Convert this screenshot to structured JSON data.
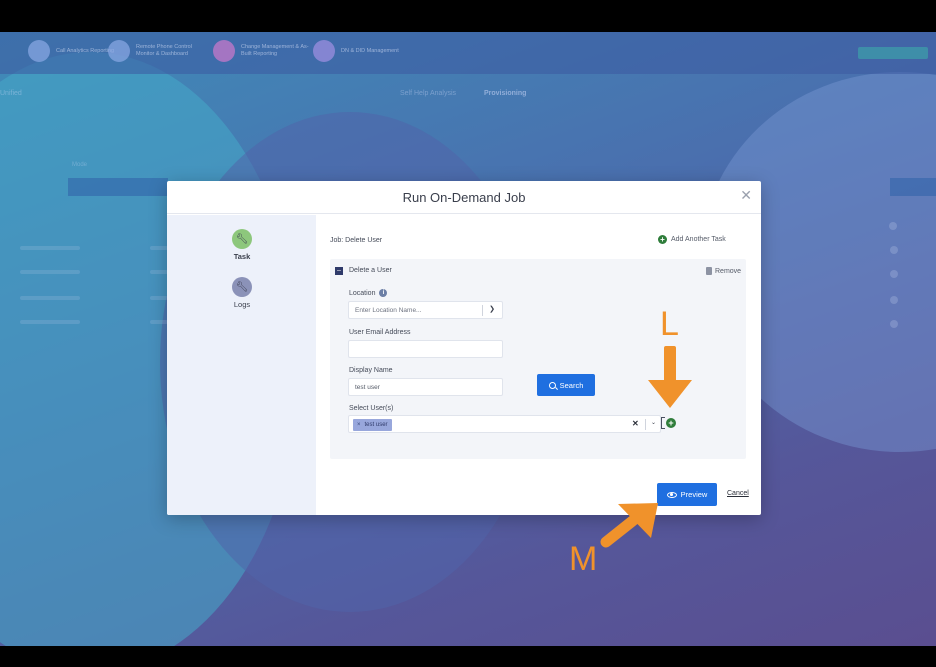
{
  "background_app": {
    "nav_items": [
      {
        "label": "Call Analytics Reporting"
      },
      {
        "label": "Remote Phone Control Monitor & Dashboard"
      },
      {
        "label": "Change Management & As-Built Reporting"
      },
      {
        "label": "DN & DID Management"
      }
    ],
    "sub_tabs": [
      "Self Help Analysis",
      "Provisioning"
    ],
    "left_label": "Mode",
    "dropdown_label": "Unified"
  },
  "modal": {
    "title": "Run On-Demand Job",
    "close_icon": "close-icon",
    "sidebar": [
      {
        "label": "Task",
        "icon": "wrench-icon",
        "active": true
      },
      {
        "label": "Logs",
        "icon": "wrench-icon",
        "active": false
      }
    ],
    "job_label": "Job: Delete User",
    "add_task_label": "Add Another Task",
    "task": {
      "title": "Delete a User",
      "remove_label": "Remove",
      "location_label": "Location",
      "location_placeholder": "Enter Location Name...",
      "email_label": "User Email Address",
      "email_value": "",
      "display_name_label": "Display Name",
      "display_name_value": "test user",
      "search_label": "Search",
      "select_users_label": "Select User(s)",
      "selected_users": [
        "test user"
      ]
    },
    "preview_label": "Preview",
    "cancel_label": "Cancel"
  },
  "annotations": {
    "letter_l": "L",
    "letter_m": "M",
    "color": "#f0922b"
  }
}
